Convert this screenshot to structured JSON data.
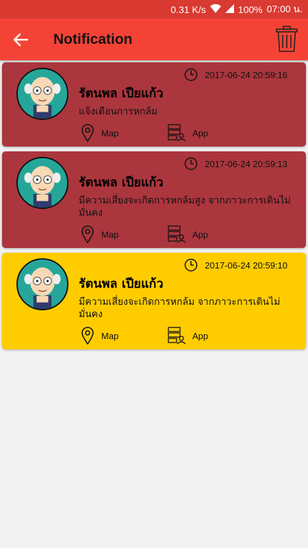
{
  "status": {
    "speed": "0.31 K/s",
    "battery": "100%",
    "time": "07:00 น."
  },
  "header": {
    "title": "Notification",
    "back_icon": "back-arrow-icon",
    "delete_icon": "trash-icon"
  },
  "colors": {
    "app_bar": "#f44336",
    "card_alert": "#ab363e",
    "card_warning": "#ffcc00"
  },
  "notifications": [
    {
      "name": "รัตนพล เปียแก้ว",
      "timestamp": "2017-06-24 20:59:16",
      "message": "แจ้งเตือนการหกล้ม",
      "map_label": "Map",
      "app_label": "App",
      "level": "alert"
    },
    {
      "name": "รัตนพล เปียแก้ว",
      "timestamp": "2017-06-24 20:59:13",
      "message": "มีความเสี่ยงจะเกิดการหกล้มสูง จากภาวะการเดินไม่มั่นคง",
      "map_label": "Map",
      "app_label": "App",
      "level": "alert"
    },
    {
      "name": "รัตนพล เปียแก้ว",
      "timestamp": "2017-06-24 20:59:10",
      "message": "มีความเสี่ยงจะเกิดการหกล้ม จากภาวะการเดินไม่มั่นคง",
      "map_label": "Map",
      "app_label": "App",
      "level": "warning"
    }
  ]
}
